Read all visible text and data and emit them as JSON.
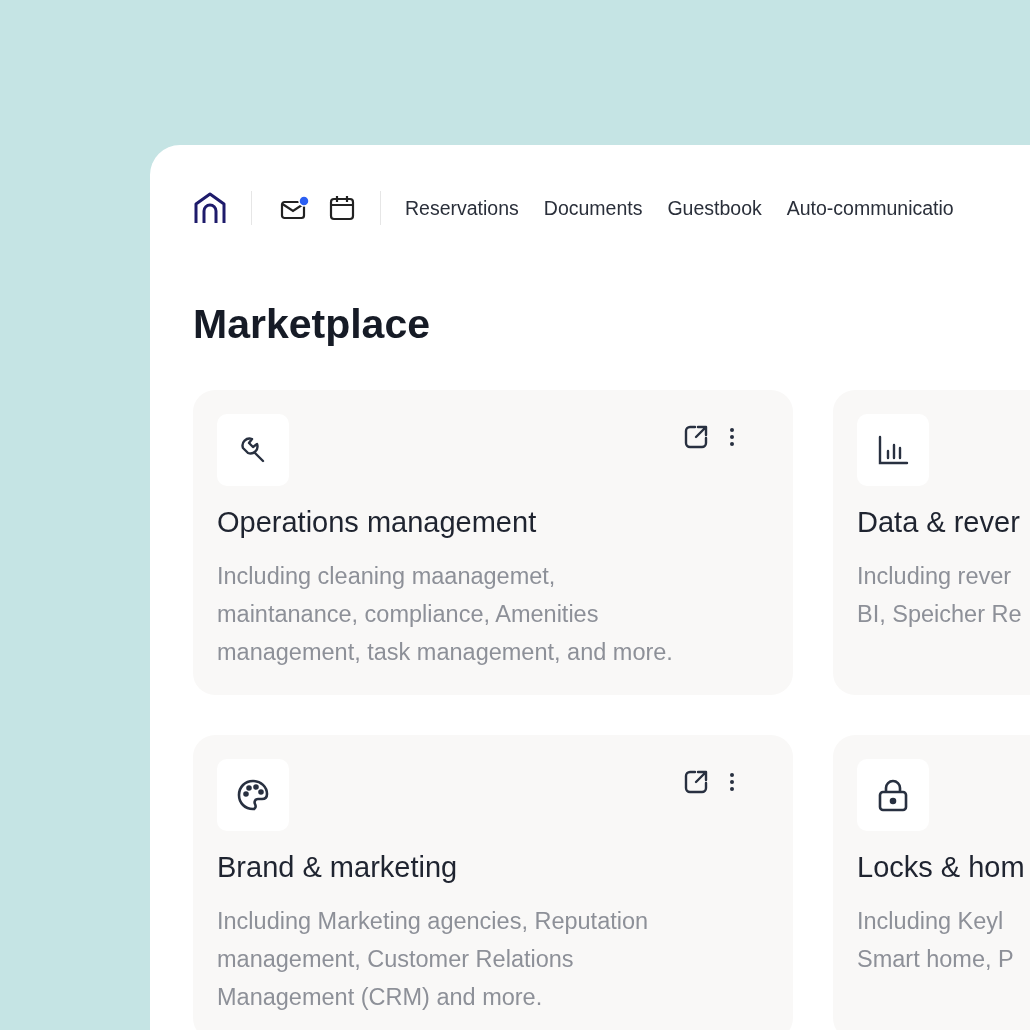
{
  "nav": {
    "mail_unread": true,
    "links": [
      {
        "label": "Reservations"
      },
      {
        "label": "Documents"
      },
      {
        "label": "Guestbook"
      },
      {
        "label": "Auto-communicatio"
      }
    ]
  },
  "page_title": "Marketplace",
  "cards": [
    {
      "kind": "wrench",
      "title": "Operations management",
      "description_lines": [
        "Including cleaning maanagemet,",
        "maintanance, compliance, Amenities",
        "management, task management, and more."
      ]
    },
    {
      "kind": "chart",
      "title": "Data & rever",
      "description_lines": [
        "Including rever",
        "BI, Speicher Re"
      ]
    },
    {
      "kind": "palette",
      "title": "Brand & marketing",
      "description_lines": [
        "Including Marketing agencies, Reputation",
        "management, Customer Relations",
        "Management (CRM) and more."
      ]
    },
    {
      "kind": "lock",
      "title": "Locks & hom",
      "description_lines": [
        "Including Keyl",
        "Smart home, P"
      ]
    }
  ]
}
